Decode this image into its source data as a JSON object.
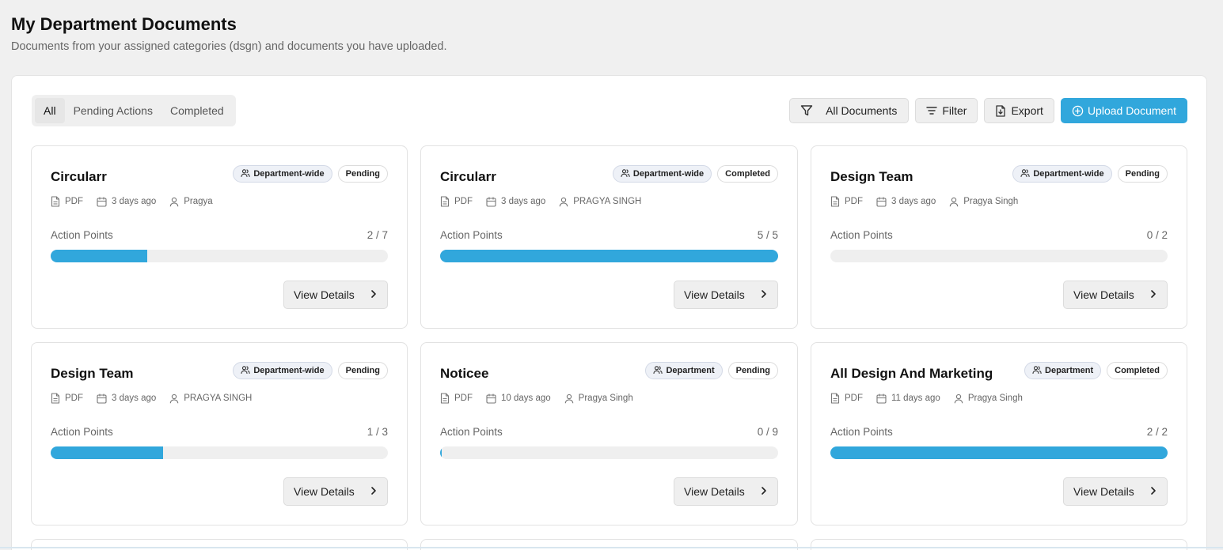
{
  "page": {
    "title": "My Department Documents",
    "subtitle": "Documents from your assigned categories (dsgn) and documents you have uploaded."
  },
  "tabs": [
    {
      "label": "All",
      "active": true
    },
    {
      "label": "Pending Actions",
      "active": false
    },
    {
      "label": "Completed",
      "active": false
    }
  ],
  "toolbar": {
    "all_documents_label": "All Documents",
    "filter_label": "Filter",
    "export_label": "Export",
    "upload_label": "Upload Document"
  },
  "colors": {
    "accent": "#31a7dc"
  },
  "card_labels": {
    "action_points": "Action Points",
    "view_details": "View Details"
  },
  "documents": [
    {
      "title": "Circularr",
      "scope": "Department-wide",
      "status": "Pending",
      "type": "PDF",
      "date": "3 days ago",
      "author": "Pragya",
      "done": 2,
      "total": 7,
      "count_text": "2 / 7"
    },
    {
      "title": "Circularr",
      "scope": "Department-wide",
      "status": "Completed",
      "type": "PDF",
      "date": "3 days ago",
      "author": "PRAGYA SINGH",
      "done": 5,
      "total": 5,
      "count_text": "5 / 5"
    },
    {
      "title": "Design Team",
      "scope": "Department-wide",
      "status": "Pending",
      "type": "PDF",
      "date": "3 days ago",
      "author": "Pragya Singh",
      "done": 0,
      "total": 2,
      "count_text": "0 / 2"
    },
    {
      "title": "Design Team",
      "scope": "Department-wide",
      "status": "Pending",
      "type": "PDF",
      "date": "3 days ago",
      "author": "PRAGYA SINGH",
      "done": 1,
      "total": 3,
      "count_text": "1 / 3"
    },
    {
      "title": "Noticee",
      "scope": "Department",
      "status": "Pending",
      "type": "PDF",
      "date": "10 days ago",
      "author": "Pragya Singh",
      "done": 0,
      "total": 9,
      "count_text": "0 / 9"
    },
    {
      "title": "All Design And Marketing",
      "scope": "Department",
      "status": "Completed",
      "type": "PDF",
      "date": "11 days ago",
      "author": "Pragya Singh",
      "done": 2,
      "total": 2,
      "count_text": "2 / 2"
    }
  ]
}
